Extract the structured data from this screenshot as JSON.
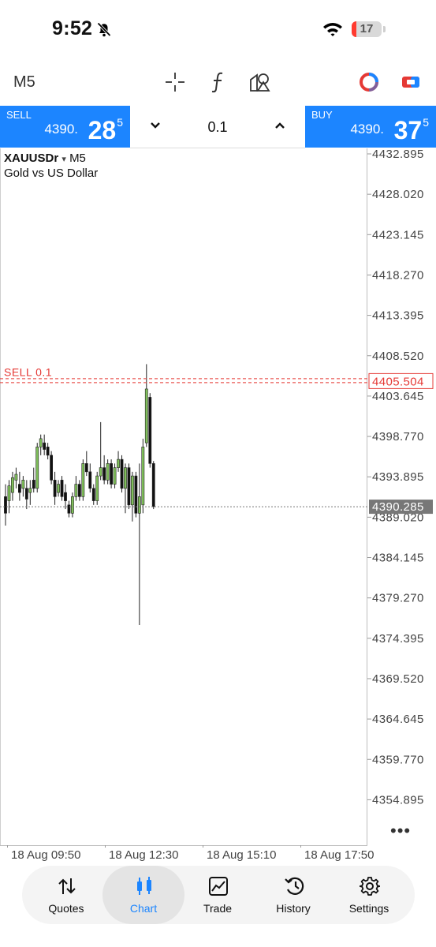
{
  "status": {
    "time": "9:52",
    "battery": "17"
  },
  "toolbar": {
    "timeframe": "M5"
  },
  "trade": {
    "sell_label": "SELL",
    "sell_price": "4390.",
    "sell_big": "28",
    "sell_sup": "5",
    "lot": "0.1",
    "buy_label": "BUY",
    "buy_price": "4390.",
    "buy_big": "37",
    "buy_sup": "5"
  },
  "chart": {
    "symbol": "XAUUSDr",
    "symbol_caret": "▾",
    "timeframe": "M5",
    "description": "Gold vs US Dollar",
    "order_label": "SELL 0.1",
    "order_price": "4405.504",
    "current_price": "4390.285",
    "more": "•••",
    "price_labels": [
      "4432.895",
      "4428.020",
      "4423.145",
      "4418.270",
      "4413.395",
      "4408.520",
      "4403.645",
      "4398.770",
      "4393.895",
      "4389.020",
      "4384.145",
      "4379.270",
      "4374.395",
      "4369.520",
      "4364.645",
      "4359.770",
      "4354.895"
    ],
    "time_labels": [
      "18 Aug 09:50",
      "18 Aug 12:30",
      "18 Aug 15:10",
      "18 Aug 17:50"
    ]
  },
  "chart_data": {
    "type": "candlestick",
    "y_ticks": [
      4432.895,
      4428.02,
      4423.145,
      4418.27,
      4413.395,
      4408.52,
      4403.645,
      4398.77,
      4393.895,
      4389.02,
      4384.145,
      4379.27,
      4374.395,
      4369.52,
      4364.645,
      4359.77,
      4354.895
    ],
    "candles": [
      [
        4391.5,
        4393.0,
        4388.0,
        4389.5
      ],
      [
        4391.0,
        4393.5,
        4389.5,
        4392.8
      ],
      [
        4392.0,
        4394.5,
        4391.0,
        4393.8
      ],
      [
        4393.5,
        4395.0,
        4392.5,
        4394.2
      ],
      [
        4393.0,
        4394.5,
        4391.0,
        4392.0
      ],
      [
        4392.5,
        4394.0,
        4391.5,
        4393.5
      ],
      [
        4392.5,
        4393.5,
        4390.0,
        4391.2
      ],
      [
        4392.0,
        4393.5,
        4390.5,
        4392.5
      ],
      [
        4393.5,
        4395.0,
        4392.0,
        4392.5
      ],
      [
        4392.5,
        4398.0,
        4392.0,
        4397.5
      ],
      [
        4397.5,
        4399.0,
        4396.5,
        4398.5
      ],
      [
        4398.0,
        4399.0,
        4396.5,
        4397.2
      ],
      [
        4397.5,
        4398.0,
        4396.0,
        4396.5
      ],
      [
        4396.5,
        4397.0,
        4393.0,
        4393.5
      ],
      [
        4393.5,
        4394.5,
        4390.5,
        4391.5
      ],
      [
        4392.0,
        4393.5,
        4391.5,
        4393.0
      ],
      [
        4393.5,
        4394.0,
        4391.0,
        4391.5
      ],
      [
        4392.0,
        4393.0,
        4390.0,
        4391.0
      ],
      [
        4390.5,
        4391.0,
        4389.0,
        4389.5
      ],
      [
        4389.5,
        4392.0,
        4389.0,
        4391.5
      ],
      [
        4391.5,
        4394.0,
        4391.0,
        4393.0
      ],
      [
        4393.0,
        4393.5,
        4391.0,
        4391.5
      ],
      [
        4391.5,
        4396.0,
        4391.0,
        4395.5
      ],
      [
        4395.5,
        4397.0,
        4394.0,
        4394.5
      ],
      [
        4394.5,
        4395.5,
        4392.0,
        4392.5
      ],
      [
        4392.5,
        4393.0,
        4390.5,
        4391.0
      ],
      [
        4391.0,
        4394.5,
        4390.5,
        4394.0
      ],
      [
        4394.0,
        4400.5,
        4393.5,
        4395.0
      ],
      [
        4395.0,
        4396.5,
        4393.0,
        4393.5
      ],
      [
        4393.5,
        4396.0,
        4393.0,
        4395.5
      ],
      [
        4395.5,
        4396.0,
        4392.5,
        4393.0
      ],
      [
        4393.0,
        4395.5,
        4392.5,
        4395.0
      ],
      [
        4395.0,
        4397.0,
        4394.5,
        4396.0
      ],
      [
        4396.0,
        4396.5,
        4392.0,
        4392.5
      ],
      [
        4392.5,
        4395.5,
        4389.5,
        4395.0
      ],
      [
        4395.0,
        4395.5,
        4390.0,
        4390.5
      ],
      [
        4390.5,
        4394.5,
        4388.5,
        4394.0
      ],
      [
        4394.0,
        4394.5,
        4389.0,
        4389.5
      ],
      [
        4389.5,
        4395.5,
        4376.0,
        4391.5
      ],
      [
        4390.5,
        4398.5,
        4389.5,
        4397.5
      ],
      [
        4398.0,
        4407.5,
        4397.5,
        4404.5
      ],
      [
        4403.5,
        4404.0,
        4395.0,
        4395.5
      ],
      [
        4395.5,
        4395.8,
        4390.0,
        4390.3
      ]
    ]
  },
  "nav": [
    {
      "label": "Quotes"
    },
    {
      "label": "Chart"
    },
    {
      "label": "Trade"
    },
    {
      "label": "History"
    },
    {
      "label": "Settings"
    }
  ]
}
